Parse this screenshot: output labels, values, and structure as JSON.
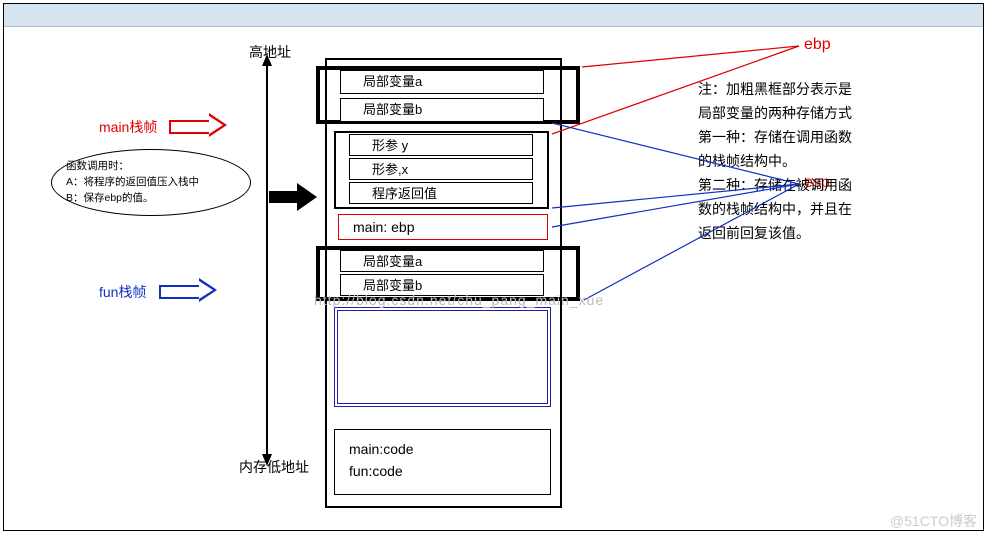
{
  "labels": {
    "high_addr": "高地址",
    "low_addr": "内存低地址",
    "main_frame": "main栈帧",
    "fun_frame": "fun栈帧",
    "ebp": "ebp",
    "esp": "esp"
  },
  "callout": {
    "title": "函数调用时：",
    "line_a": "A：将程序的返回值压入栈中",
    "line_b": "B：保存ebp的值。"
  },
  "stack": {
    "local_a_1": "局部变量a",
    "local_b_1": "局部变量b",
    "param_y": "形参 y",
    "param_x": "形参,x",
    "ret": "程序返回值",
    "main_ebp": "main: ebp",
    "local_a_2": "局部变量a",
    "local_b_2": "局部变量b"
  },
  "code": {
    "main": "main:code",
    "fun": "fun:code"
  },
  "notes": {
    "l1": "注：加粗黑框部分表示是",
    "l2": "局部变量的两种存储方式",
    "l3": "第一种：存储在调用函数",
    "l4": "的栈帧结构中。",
    "l5": "第二种：存储在被调用函",
    "l6": "数的栈帧结构中，并且在",
    "l7": "返回前回复该值。"
  },
  "watermark": {
    "blog": "http://blog.csdn.net/chu_pang_main_xue",
    "cto": "@51CTO博客"
  }
}
